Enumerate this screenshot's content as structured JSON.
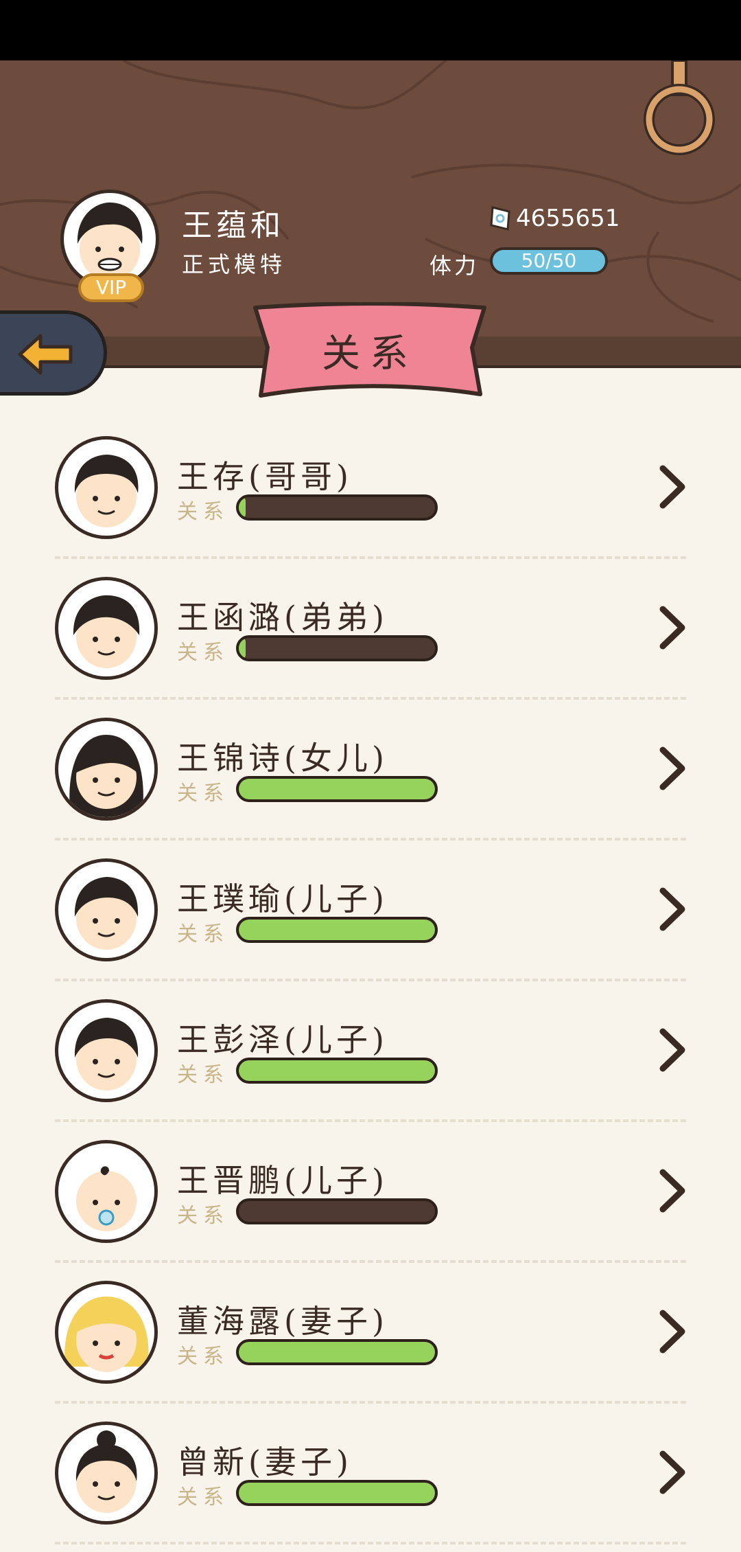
{
  "profile": {
    "name": "王蕴和",
    "title": "正式模特",
    "vip_label": "VIP",
    "money": "4655651",
    "stamina_label": "体力",
    "stamina": "50/50"
  },
  "page_title": "关系",
  "relations": [
    {
      "name": "王存(哥哥)",
      "label": "关系",
      "level": 0.03,
      "avatar": "older-brother-avatar"
    },
    {
      "name": "王函潞(弟弟)",
      "label": "关系",
      "level": 0.03,
      "avatar": "younger-brother-avatar"
    },
    {
      "name": "王锦诗(女儿)",
      "label": "关系",
      "level": 1.0,
      "avatar": "daughter-avatar"
    },
    {
      "name": "王璞瑜(儿子)",
      "label": "关系",
      "level": 1.0,
      "avatar": "son-avatar"
    },
    {
      "name": "王彭泽(儿子)",
      "label": "关系",
      "level": 1.0,
      "avatar": "son-avatar"
    },
    {
      "name": "王晋鹏(儿子)",
      "label": "关系",
      "level": 0.0,
      "avatar": "baby-son-avatar"
    },
    {
      "name": "董海露(妻子)",
      "label": "关系",
      "level": 1.0,
      "avatar": "wife-blonde-avatar"
    },
    {
      "name": "曾新(妻子)",
      "label": "关系",
      "level": 1.0,
      "avatar": "wife-bun-avatar"
    }
  ],
  "colors": {
    "wood": "#6d4c3e",
    "bar_fill": "#96d35c",
    "bar_empty": "#4e3a32",
    "banner": "#ef8494",
    "stamina": "#6cc1dc",
    "background": "#f8f4ec"
  },
  "icons": {
    "back": "arrow-left-icon",
    "money": "banknote-icon",
    "row_action": "chevron-right-icon",
    "decor": "hanging-ring-icon"
  }
}
